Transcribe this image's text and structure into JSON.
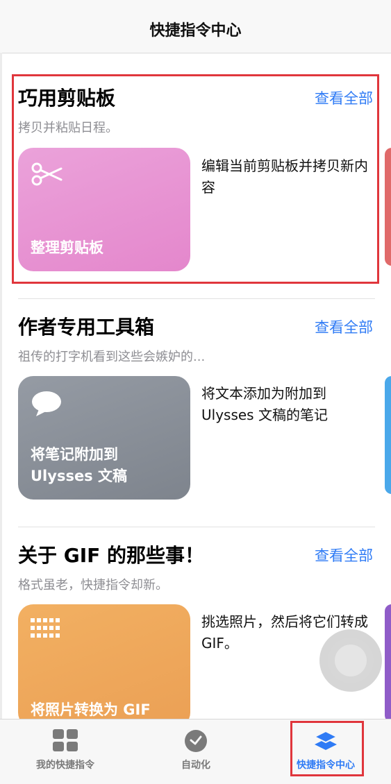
{
  "header": {
    "title": "快捷指令中心"
  },
  "sections": [
    {
      "title": "巧用剪贴板",
      "see_all": "查看全部",
      "subtitle": "拷贝并粘贴日程。",
      "card": {
        "label": "整理剪贴板",
        "icon": "scissors-icon",
        "color": "#e79ad5"
      },
      "description": "编辑当前剪贴板并拷贝新内容",
      "peek_color": "#e06a6a"
    },
    {
      "title": "作者专用工具箱",
      "see_all": "查看全部",
      "subtitle": "祖传的打字机看到这些会嫉妒的...",
      "card": {
        "label": "将笔记附加到 Ulysses 文稿",
        "icon": "speech-bubble-icon",
        "color": "#8a9099"
      },
      "description": "将文本添加为附加到 Ulysses 文稿的笔记",
      "peek_color": "#4aa8ea"
    },
    {
      "title": "关于 GIF 的那些事！",
      "see_all": "查看全部",
      "subtitle": "格式虽老，快捷指令却新。",
      "card": {
        "label": "将照片转换为 GIF",
        "icon": "grid-dots-icon",
        "color": "#efa85a"
      },
      "description": "挑选照片，然后将它们转成 GIF。",
      "peek_color": "#8f5cc8"
    }
  ],
  "tabbar": {
    "tabs": [
      {
        "label": "我的快捷指令",
        "icon": "grid-icon"
      },
      {
        "label": "自动化",
        "icon": "clock-icon"
      },
      {
        "label": "快捷指令中心",
        "icon": "layers-icon",
        "active": true
      }
    ]
  },
  "colors": {
    "accent": "#2f7bf5",
    "highlight_box": "#e0363c"
  }
}
